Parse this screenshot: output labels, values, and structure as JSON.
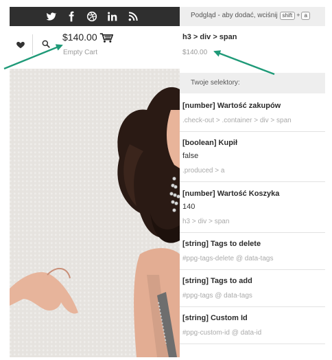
{
  "social_icons": [
    "twitter-icon",
    "facebook-icon",
    "dribbble-icon",
    "linkedin-icon",
    "rss-icon"
  ],
  "header": {
    "price": "$140.00",
    "empty_cart": "Empty Cart"
  },
  "panel": {
    "preview_text": "Podgląd - aby dodać, wciśnij",
    "key_shift": "shift",
    "key_plus": "+",
    "key_a": "a",
    "current_path": "h3 > div > span",
    "current_value": "$140.00",
    "selectors_label": "Twoje selektory:",
    "selectors": [
      {
        "title": "[number] Wartość zakupów",
        "value": "",
        "selector": ".check-out > .container > div > span"
      },
      {
        "title": "[boolean] Kupił",
        "value": "false",
        "selector": ".produced > a"
      },
      {
        "title": "[number] Wartość Koszyka",
        "value": "140",
        "selector": "h3 > div > span"
      },
      {
        "title": "[string] Tags to delete",
        "value": "",
        "selector": "#ppg-tags-delete @ data-tags"
      },
      {
        "title": "[string] Tags to add",
        "value": "",
        "selector": "#ppg-tags @ data-tags"
      },
      {
        "title": "[string] Custom Id",
        "value": "",
        "selector": "#ppg-custom-id @ data-id"
      }
    ]
  },
  "colors": {
    "topbar": "#2f2f2f",
    "arrow": "#1f9a78",
    "panel_header": "#eeeeee"
  }
}
